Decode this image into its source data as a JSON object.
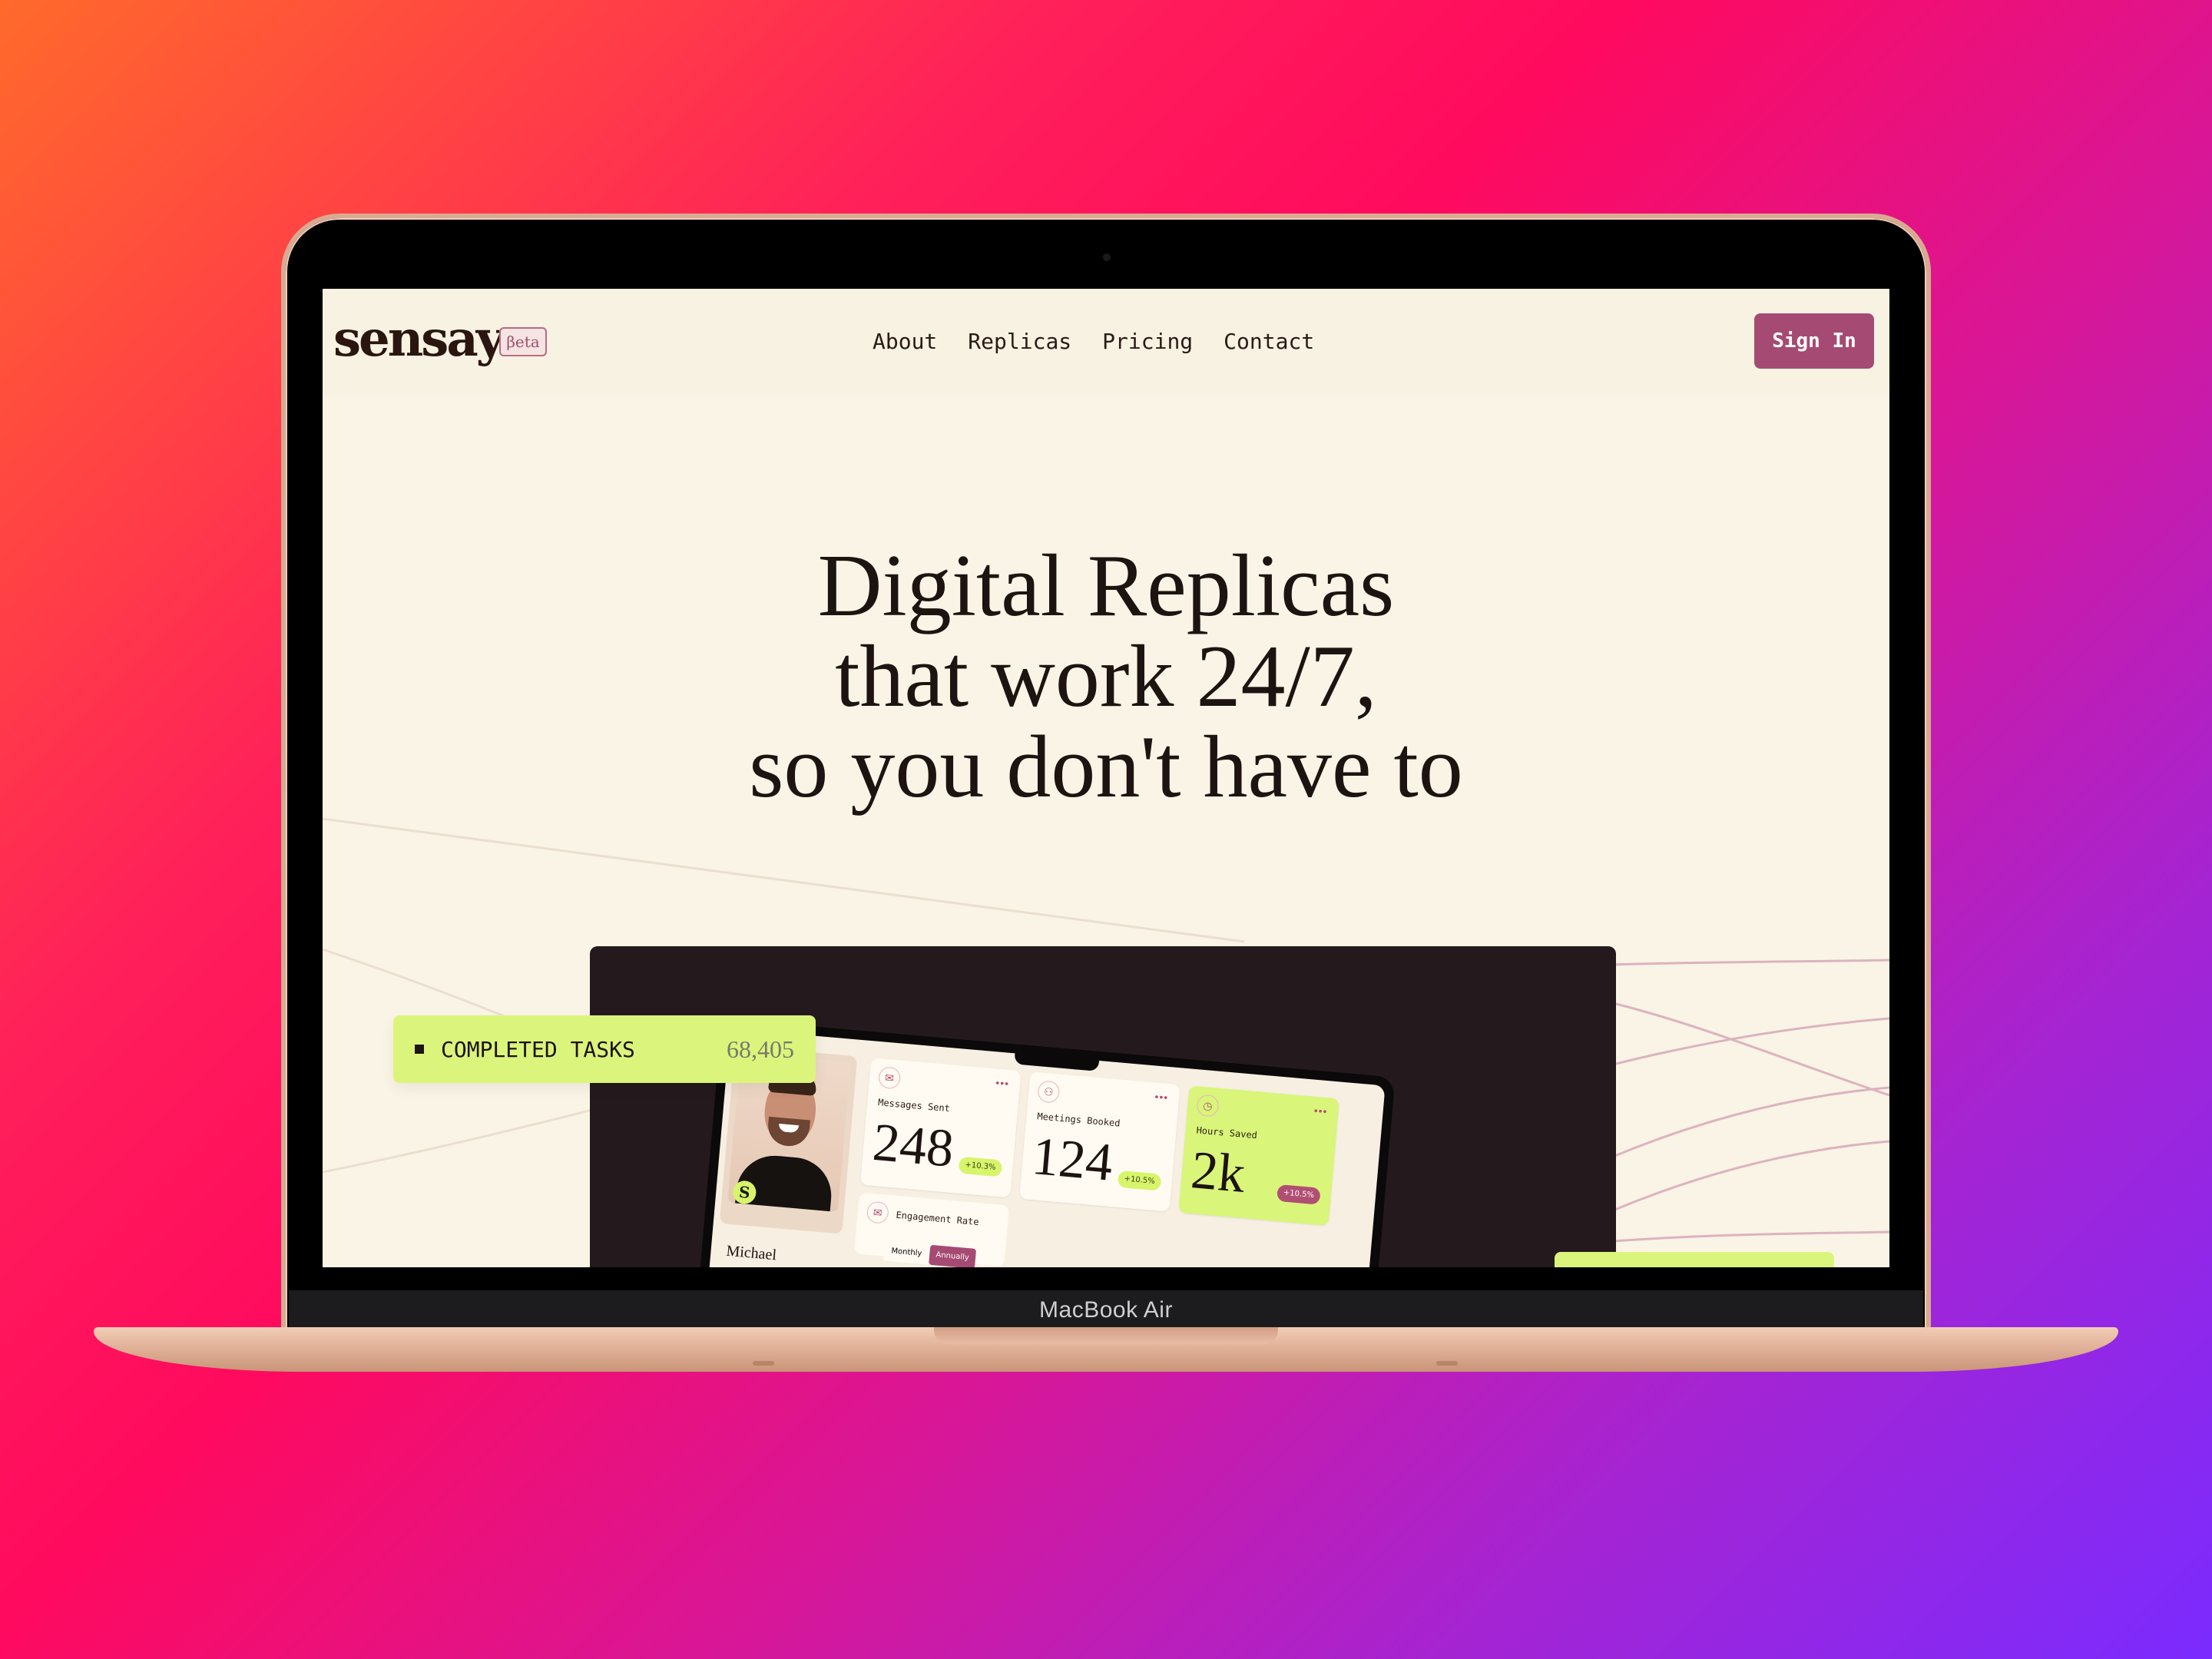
{
  "device": {
    "model_label": "MacBook Air"
  },
  "nav": {
    "logo": "sensay",
    "badge": "βeta",
    "links": [
      "About",
      "Replicas",
      "Pricing",
      "Contact"
    ],
    "sign_in": "Sign In"
  },
  "hero": {
    "line1": "Digital Replicas",
    "line2": "that work 24/7,",
    "line3": "so you don't have to"
  },
  "tasks": {
    "label": "COMPLETED TASKS",
    "value": "68,405"
  },
  "dashboard": {
    "profile_name": "Michael",
    "profile_badge": "S",
    "cards": [
      {
        "label": "Messages Sent",
        "value": "248",
        "change": "+10.3%"
      },
      {
        "label": "Meetings Booked",
        "value": "124",
        "change": "+10.5%"
      },
      {
        "label": "Hours Saved",
        "value": "2k",
        "change": "+10.5%"
      }
    ],
    "engagement_label": "Engagement Rate",
    "toggle": [
      "Monthly",
      "Annually"
    ]
  },
  "colors": {
    "screen_bg": "#faf4e6",
    "accent": "#a54a72",
    "lime": "#dbf57c",
    "ink": "#1d1310"
  }
}
